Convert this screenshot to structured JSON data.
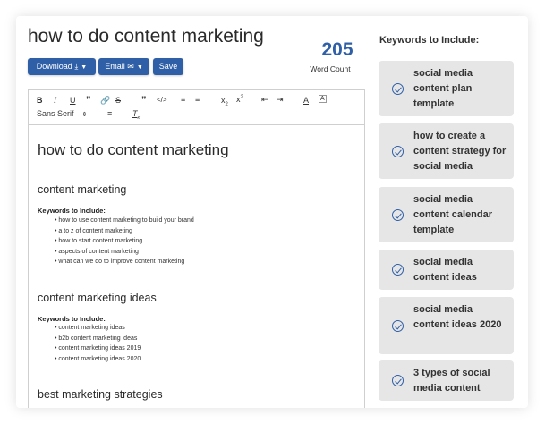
{
  "doc": {
    "title": "how to do content marketing"
  },
  "buttons": {
    "download": "Download",
    "email": "Email",
    "save": "Save"
  },
  "word_count": {
    "value": "205",
    "label": "Word Count"
  },
  "toolbar": {
    "font": "Sans Serif"
  },
  "content": {
    "h1": "how to do content marketing",
    "sections": [
      {
        "heading": "content marketing",
        "kw_label": "Keywords to Include:",
        "items": [
          "how to use content marketing to build your brand",
          "a to z of content marketing",
          "how to start content marketing",
          "aspects of content marketing",
          "what can we do to improve content marketing"
        ]
      },
      {
        "heading": "content marketing ideas",
        "kw_label": "Keywords to Include:",
        "items": [
          "content marketing ideas",
          "b2b content marketing ideas",
          "content marketing ideas 2019",
          "content marketing ideas 2020"
        ]
      },
      {
        "heading": "best marketing strategies"
      }
    ]
  },
  "sidebar": {
    "title": "Keywords to Include:",
    "keywords": [
      "social media content plan template",
      "how to create a content strategy for social media",
      "social media content calendar template",
      "social media content ideas",
      "social media content ideas 2020",
      "3 types of social media content"
    ]
  }
}
